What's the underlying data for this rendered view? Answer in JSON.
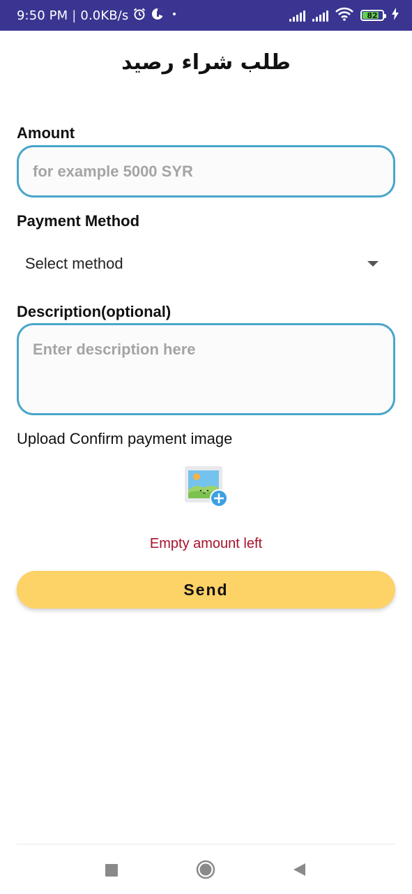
{
  "status_bar": {
    "time": "9:50 PM",
    "separator": "|",
    "network_speed": "0.0KB/s",
    "left_icons": [
      "alarm-icon",
      "data-saver-icon",
      "dot-icon"
    ],
    "right_icons": [
      "signal-icon",
      "signal-icon-2",
      "wifi-icon",
      "battery-icon",
      "charging-icon"
    ],
    "battery_level": "82",
    "battery_fraction": 0.82,
    "background_color": "#3a3591"
  },
  "page": {
    "title": "طلب شراء رصيد"
  },
  "form": {
    "amount": {
      "label": "Amount",
      "value": "",
      "placeholder": "for example 5000 SYR"
    },
    "payment_method": {
      "label": "Payment Method",
      "selected": "Select method",
      "icon": "dropdown-arrow-icon"
    },
    "description": {
      "label": "Description(optional)",
      "value": "",
      "placeholder": "Enter description here"
    },
    "upload": {
      "label": "Upload Confirm payment image",
      "icon": "add-image-icon"
    },
    "error_message": "Empty amount left",
    "submit_label": "Send"
  },
  "nav_bar": {
    "buttons": [
      "recents-icon",
      "home-icon",
      "back-icon"
    ]
  },
  "colors": {
    "accent_border": "#4aa6c9",
    "button": "#fdd267",
    "error": "#a8102b"
  }
}
